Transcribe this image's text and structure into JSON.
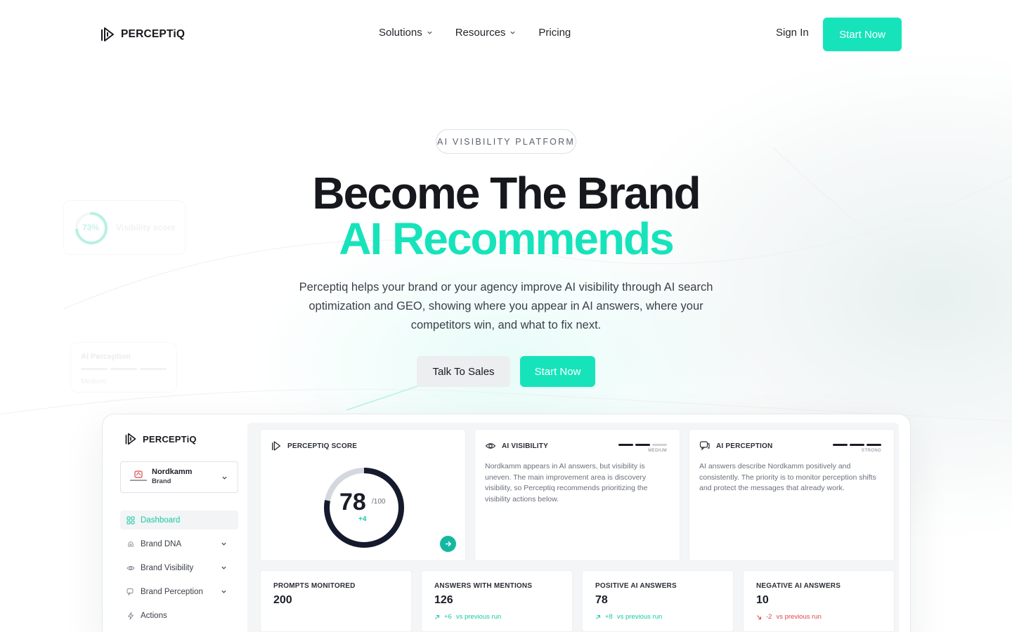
{
  "brand": {
    "name": "PERCEPTiQ"
  },
  "nav": {
    "links": [
      {
        "label": "Solutions",
        "dropdown": true
      },
      {
        "label": "Resources",
        "dropdown": true
      },
      {
        "label": "Pricing",
        "dropdown": false
      }
    ],
    "sign_in": "Sign In",
    "start_now": "Start Now"
  },
  "hero": {
    "eyebrow": "AI VISIBILITY PLATFORM",
    "title_line1": "Become The Brand",
    "title_line2": "AI Recommends",
    "subtitle": "Perceptiq helps your brand or your agency improve AI visibility through AI search optimization and GEO, showing where you appear in AI answers, where your competitors win, and what to fix next.",
    "cta_secondary": "Talk To Sales",
    "cta_primary": "Start Now",
    "accent_color": "#17e3bb"
  },
  "floating": {
    "visibility": {
      "percent": "73%",
      "label": "Visibility score"
    },
    "perception": {
      "label": "AI Perception",
      "level": "Medium"
    }
  },
  "app": {
    "sidebar": {
      "brand_select": {
        "name": "Nordkamm",
        "type": "Brand"
      },
      "items": [
        {
          "label": "Dashboard",
          "icon": "grid-icon",
          "active": true
        },
        {
          "label": "Brand DNA",
          "icon": "fingerprint-icon",
          "expandable": true
        },
        {
          "label": "Brand Visibility",
          "icon": "eye-icon",
          "expandable": true
        },
        {
          "label": "Brand Perception",
          "icon": "chat-icon",
          "expandable": true
        },
        {
          "label": "Actions",
          "icon": "bolt-icon"
        }
      ]
    },
    "score": {
      "title": "PERCEPTIQ SCORE",
      "value": "78",
      "max": "/100",
      "delta": "+4",
      "fraction": 0.78
    },
    "visibility": {
      "title": "AI VISIBILITY",
      "level": "MEDIUM",
      "bars_filled": 2,
      "body": "Nordkamm appears in AI answers, but visibility is uneven. The main improvement area is discovery visibility, so Perceptiq recommends prioritizing the visibility actions below."
    },
    "perception": {
      "title": "AI PERCEPTION",
      "level": "STRONG",
      "bars_filled": 3,
      "body": "AI answers describe Nordkamm positively and consistently. The priority is to monitor perception shifts and protect the messages that already work."
    },
    "stats": [
      {
        "label": "PROMPTS MONITORED",
        "value": "200",
        "delta": "",
        "note": ""
      },
      {
        "label": "ANSWERS WITH MENTIONS",
        "value": "126",
        "delta": "+6",
        "note": "vs previous run",
        "trend": "up"
      },
      {
        "label": "POSITIVE AI ANSWERS",
        "value": "78",
        "delta": "+8",
        "note": "vs previous run",
        "trend": "up"
      },
      {
        "label": "NEGATIVE AI ANSWERS",
        "value": "10",
        "delta": "-2",
        "note": "vs previous run",
        "trend": "down"
      }
    ]
  }
}
